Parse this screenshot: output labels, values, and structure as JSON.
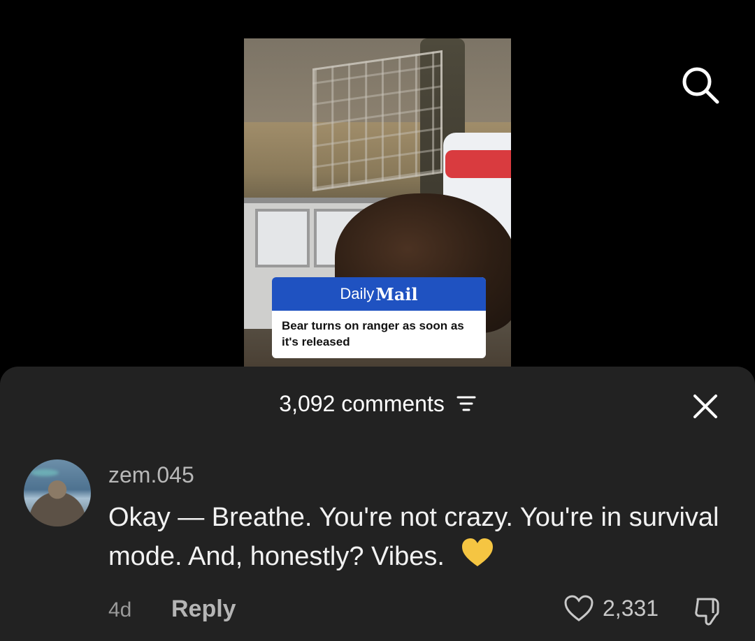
{
  "video": {
    "brand_daily": "Daily",
    "brand_mail": "Mail",
    "caption": "Bear turns on ranger as soon as it's released"
  },
  "comments_header": {
    "count_label": "3,092 comments"
  },
  "comment": {
    "username": "zem.045",
    "text": "Okay — Breathe. You're not crazy. You're in survival mode. And, honestly? Vibes.",
    "time": "4d",
    "reply_label": "Reply",
    "likes": "2,331"
  },
  "icons": {
    "search": "search-icon",
    "filter": "filter-icon",
    "close": "close-icon",
    "like": "heart-outline-icon",
    "dislike": "thumbs-down-icon",
    "emoji": "yellow-heart-emoji"
  },
  "colors": {
    "background": "#000000",
    "sheet": "#222222",
    "daily_mail_blue": "#1f52c1",
    "emoji_yellow": "#f5c542"
  }
}
